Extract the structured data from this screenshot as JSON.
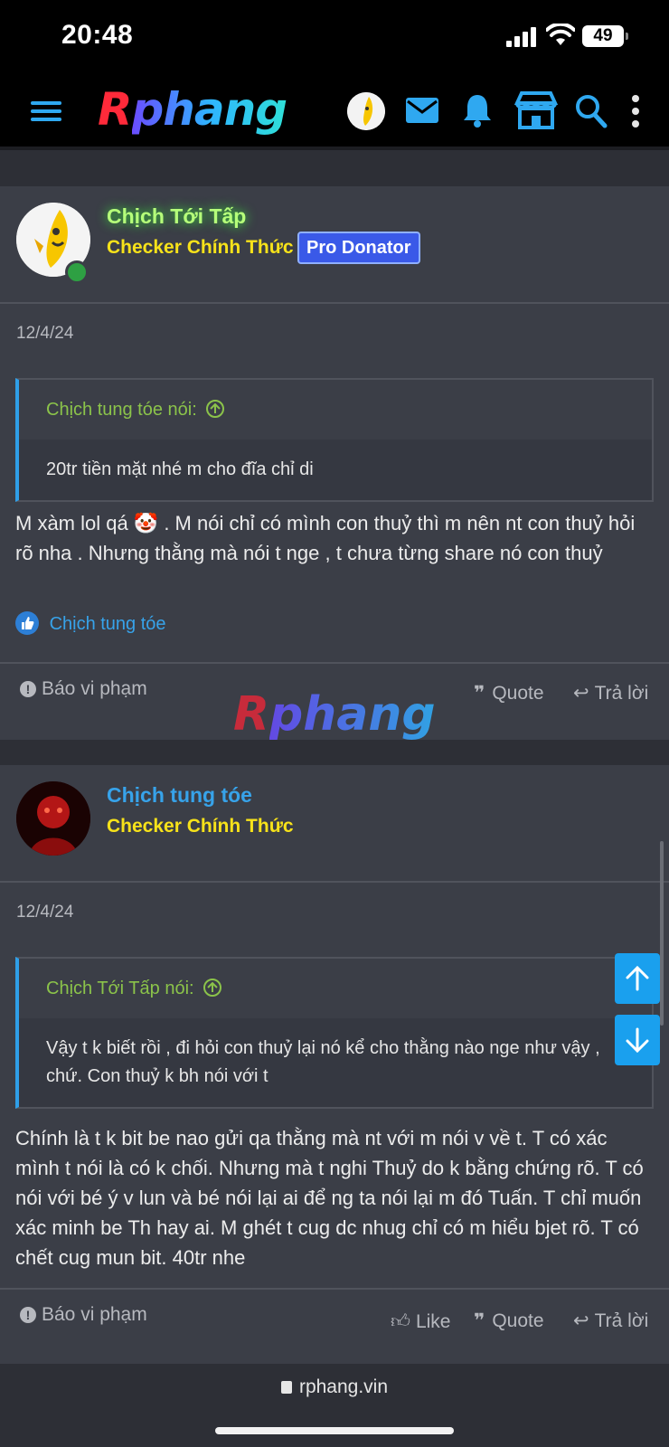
{
  "status": {
    "time": "20:48",
    "battery": "49"
  },
  "nav": {
    "logo_r": "R",
    "logo_rest": "phang",
    "icons": [
      "menu-icon",
      "avatar",
      "mail-icon",
      "bell-icon",
      "store-icon",
      "search-icon",
      "more-icon"
    ]
  },
  "posts": [
    {
      "username": "Chịch Tới Tấp",
      "username_color": "#b6ff7a",
      "rank": "Checker Chính Thức",
      "badge": "Pro Donator",
      "date": "12/4/24",
      "quote_author": "Chịch tung tóe nói:",
      "quote_text": "20tr tiền mặt nhé m cho đĩa chỉ di",
      "message": "M xàm lol qá 🤡 . M nói chỉ có mình con thuỷ thì m nên nt con thuỷ hỏi rõ nha . Nhưng thằng mà nói t nge , t chưa từng share nó con thuỷ",
      "liked_by": "Chịch tung tóe",
      "report": "Báo vi phạm",
      "quote_btn": "Quote",
      "reply_btn": "Trả lời"
    },
    {
      "username": "Chịch tung tóe",
      "username_color": "#37a3ea",
      "rank": "Checker Chính Thức",
      "date": "12/4/24",
      "quote_author": "Chịch Tới Tấp nói:",
      "quote_text": "Vậy t k biết rồi , đi hỏi con thuỷ lại nó kể cho thằng nào nge như vậy , chứ. Con thuỷ k bh nói với t",
      "message": "Chính là t k bit be nao gửi qa thằng mà nt với m nói v về t. T có xác mình t nói là có k chối. Nhưng mà t nghi Thuỷ do k bằng chứng rõ. T có nói với bé ý v lun và bé nói lại ai để ng ta nói lại m đó Tuấn. T chỉ muốn xác minh be Th hay ai. M ghét t cug dc nhug chỉ có m hiểu bjet rõ. T có chết cug mun bit. 40tr nhe",
      "report": "Báo vi phạm",
      "like_btn": "Like",
      "quote_btn": "Quote",
      "reply_btn": "Trả lời"
    }
  ],
  "watermark": "Rphang",
  "browser": {
    "url": "rphang.vin"
  }
}
